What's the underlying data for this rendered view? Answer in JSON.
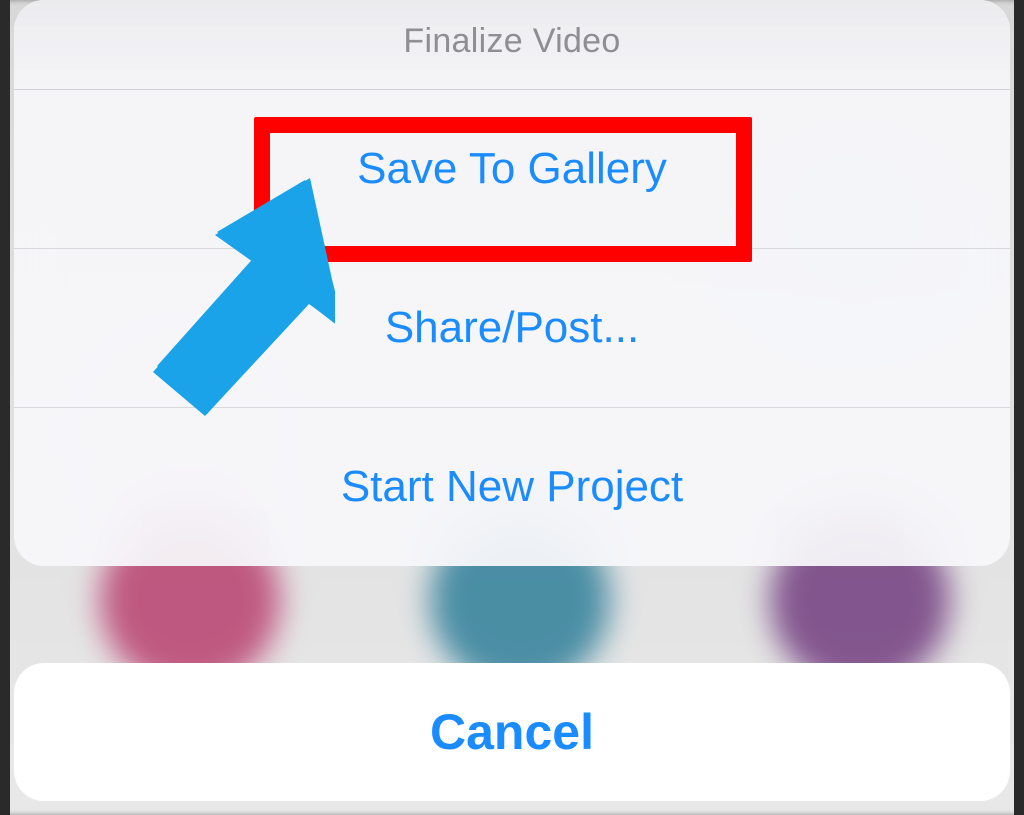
{
  "sheet": {
    "title": "Finalize Video",
    "options": [
      {
        "label": "Save To Gallery"
      },
      {
        "label": "Share/Post..."
      },
      {
        "label": "Start New Project"
      }
    ],
    "cancel": "Cancel"
  },
  "annotation": {
    "highlight_target": "save-to-gallery-option",
    "arrow_color": "#1aa3e8",
    "highlight_color": "#ff0000"
  }
}
